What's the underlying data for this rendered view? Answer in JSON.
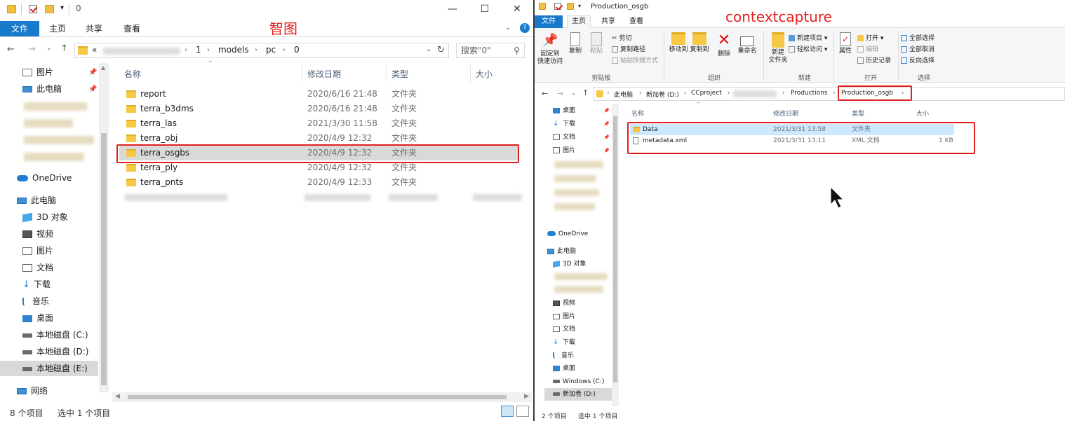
{
  "annotations": {
    "left_label": "智图",
    "right_label": "contextcapture"
  },
  "left": {
    "title": "0",
    "tabs": [
      "文件",
      "主页",
      "共享",
      "查看"
    ],
    "breadcrumb": {
      "prefix": "«",
      "parts": [
        "1",
        "models",
        "pc",
        "0"
      ]
    },
    "search_placeholder": "搜索\"0\"",
    "columns": {
      "name": "名称",
      "date": "修改日期",
      "type": "类型",
      "size": "大小"
    },
    "files": [
      {
        "name": "report",
        "date": "2020/6/16 21:48",
        "type": "文件夹"
      },
      {
        "name": "terra_b3dms",
        "date": "2020/6/16 21:48",
        "type": "文件夹"
      },
      {
        "name": "terra_las",
        "date": "2021/3/30 11:58",
        "type": "文件夹"
      },
      {
        "name": "terra_obj",
        "date": "2020/4/9 12:32",
        "type": "文件夹"
      },
      {
        "name": "terra_osgbs",
        "date": "2020/4/9 12:32",
        "type": "文件夹"
      },
      {
        "name": "terra_ply",
        "date": "2020/4/9 12:32",
        "type": "文件夹"
      },
      {
        "name": "terra_pnts",
        "date": "2020/4/9 12:33",
        "type": "文件夹"
      }
    ],
    "nav_quick": [
      "图片",
      "此电脑"
    ],
    "nav": {
      "onedrive": "OneDrive",
      "this_pc": "此电脑",
      "items": [
        "3D 对象",
        "视频",
        "图片",
        "文档",
        "下载",
        "音乐",
        "桌面",
        "本地磁盘 (C:)",
        "本地磁盘 (D:)",
        "本地磁盘 (E:)"
      ],
      "network": "网络"
    },
    "status": {
      "count": "8 个项目",
      "selected": "选中 1 个项目"
    }
  },
  "right": {
    "title": "Production_osgb",
    "tabs": [
      "文件",
      "主页",
      "共享",
      "查看"
    ],
    "ribbon": {
      "pin": "固定到\n快速访问",
      "copy": "复制",
      "paste": "粘贴",
      "cut": "剪切",
      "copy_path": "复制路径",
      "paste_shortcut": "粘贴快捷方式",
      "move_to": "移动到",
      "copy_to": "复制到",
      "delete": "删除",
      "rename": "重命名",
      "new_folder": "新建\n文件夹",
      "new_item": "新建项目",
      "easy_access": "轻松访问",
      "properties": "属性",
      "open": "打开",
      "edit": "编辑",
      "history": "历史记录",
      "select_all": "全部选择",
      "select_none": "全部取消",
      "invert": "反向选择",
      "groups": [
        "剪贴板",
        "组织",
        "新建",
        "打开",
        "选择"
      ]
    },
    "breadcrumb": [
      "此电脑",
      "新加卷 (D:)",
      "CCproject",
      "Productions",
      "Production_osgb"
    ],
    "columns": {
      "name": "名称",
      "date": "修改日期",
      "type": "类型",
      "size": "大小"
    },
    "files": [
      {
        "name": "Data",
        "date": "2021/3/31 13:58",
        "type": "文件夹",
        "size": ""
      },
      {
        "name": "metadata.xml",
        "date": "2021/3/31 13:11",
        "type": "XML 文档",
        "size": "1 KB"
      }
    ],
    "nav": {
      "quick": [
        "桌面",
        "下载",
        "文档",
        "图片"
      ],
      "onedrive": "OneDrive",
      "this_pc": "此电脑",
      "items": [
        "3D 对象",
        "视频",
        "图片",
        "文档",
        "下载",
        "音乐",
        "桌面",
        "Windows (C:)",
        "新加卷 (D:)"
      ]
    },
    "status": {
      "count": "2 个项目",
      "selected": "选中 1 个项目"
    }
  },
  "colors": {
    "accent": "#1979ca",
    "highlight": "#e02020",
    "selected_row": "#d9d9d9",
    "hover_row": "#cce8ff"
  }
}
